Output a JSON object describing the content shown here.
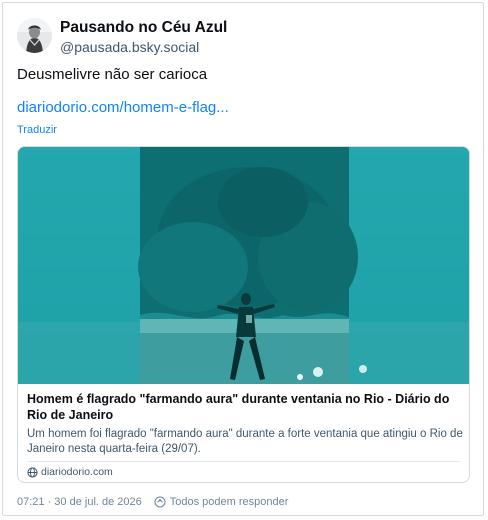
{
  "post": {
    "display_name": "Pausando no Céu Azul",
    "handle": "@pausada.bsky.social",
    "text": "Deusmelivre não ser carioca",
    "link_text": "diariodorio.com/homem-e-flag...",
    "translate_label": "Traduzir",
    "timestamp": "07:21 · 30 de jul. de 2026",
    "reply_setting": "Todos podem responder"
  },
  "embed": {
    "title": "Homem é flagrado \"farmando aura\" durante ventania no Rio - Diário do Rio de Janeiro",
    "description": "Um homem foi flagrado \"farmando aura\" durante a forte ventania que atingiu o Rio de Janeiro nesta quarta-feira (29/07).",
    "domain": "diariodorio.com",
    "thumbnail_tint": "#1a9fa6"
  },
  "icons": {
    "avatar": "avatar-image",
    "globe": "globe-icon",
    "reply": "reply-settings-icon"
  },
  "colors": {
    "link": "#1083fe",
    "text": "#0b0f14",
    "muted": "#42576c",
    "border": "#d4dbe2"
  }
}
